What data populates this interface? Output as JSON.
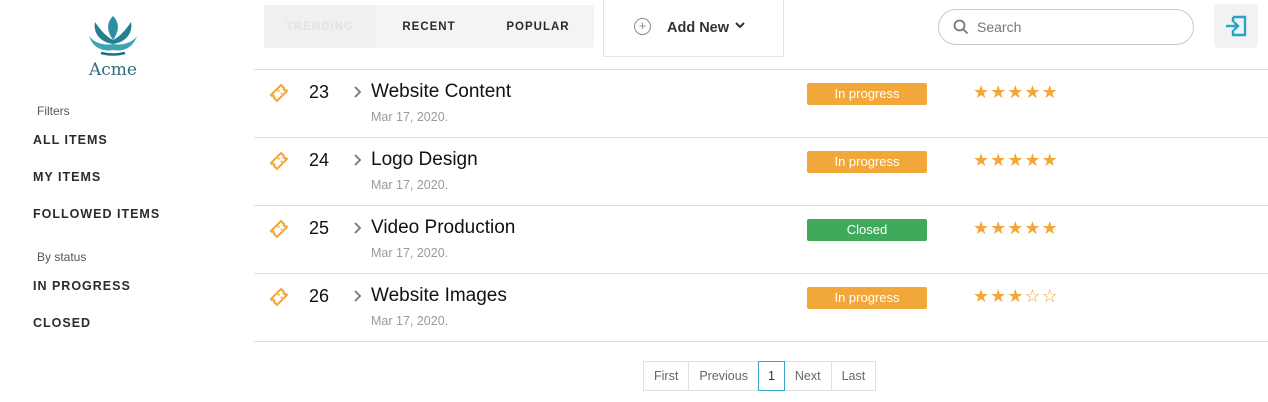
{
  "app": {
    "name": "Acme"
  },
  "sidebar": {
    "filters_heading": "Filters",
    "filter_items": [
      "ALL ITEMS",
      "MY ITEMS",
      "FOLLOWED ITEMS"
    ],
    "status_heading": "By status",
    "status_items": [
      "IN PROGRESS",
      "CLOSED"
    ]
  },
  "tabs": [
    {
      "label": "TRENDING",
      "active": true
    },
    {
      "label": "RECENT",
      "active": false
    },
    {
      "label": "POPULAR",
      "active": false
    }
  ],
  "add_new": {
    "label": "Add New",
    "icon": "plus-circle-icon"
  },
  "search": {
    "placeholder": "Search",
    "value": ""
  },
  "logout": {
    "icon": "logout-icon"
  },
  "colors": {
    "accent": "#38a6c9",
    "orange": "#f2a73a",
    "green": "#3faa5a",
    "logo": "#2b8fa0"
  },
  "items": [
    {
      "id": "23",
      "title": "Website Content",
      "date": "Mar 17, 2020.",
      "status": "In progress",
      "status_color": "#f2a73a",
      "rating": 5
    },
    {
      "id": "24",
      "title": "Logo Design",
      "date": "Mar 17, 2020.",
      "status": "In progress",
      "status_color": "#f2a73a",
      "rating": 5
    },
    {
      "id": "25",
      "title": "Video Production",
      "date": "Mar 17, 2020.",
      "status": "Closed",
      "status_color": "#3faa5a",
      "rating": 5
    },
    {
      "id": "26",
      "title": "Website Images",
      "date": "Mar 17, 2020.",
      "status": "In progress",
      "status_color": "#f2a73a",
      "rating": 3
    }
  ],
  "pagination": {
    "first": "First",
    "previous": "Previous",
    "current": "1",
    "next": "Next",
    "last": "Last"
  }
}
